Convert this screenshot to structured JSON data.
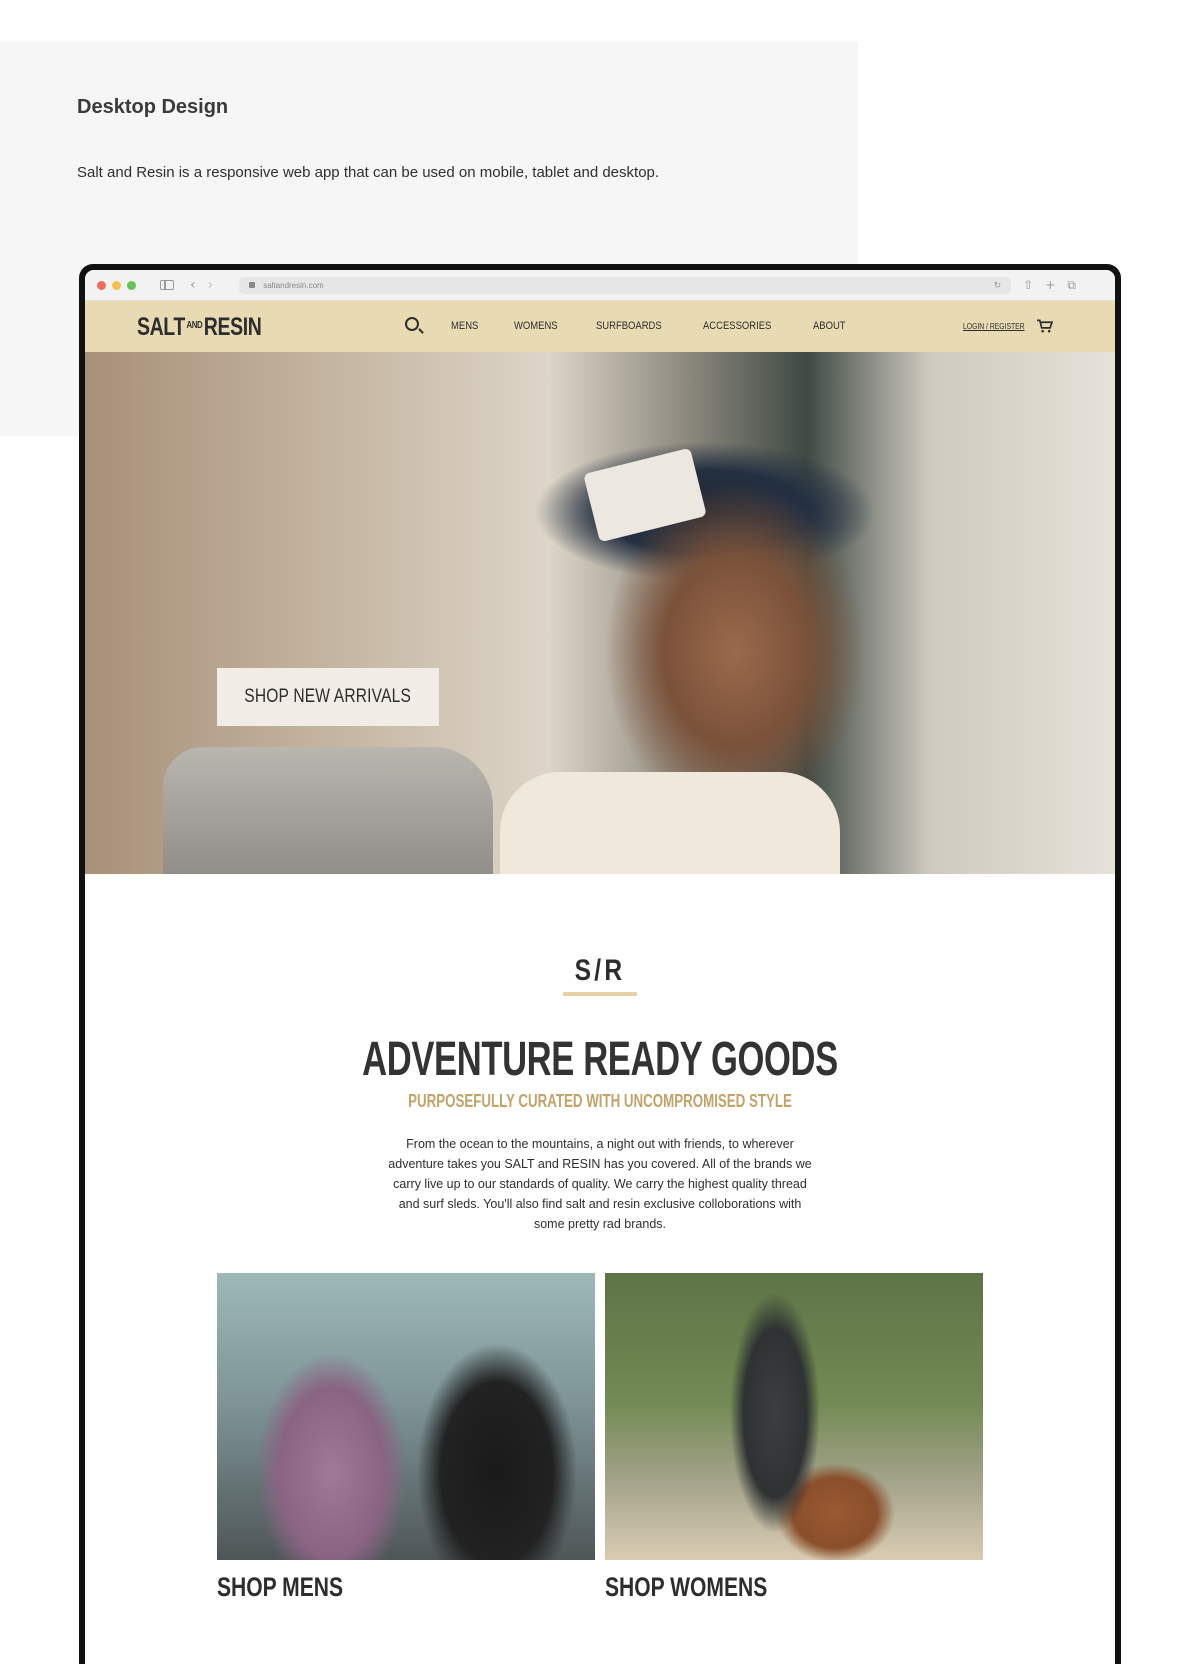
{
  "case_study": {
    "title": "Desktop Design",
    "description": "Salt and Resin is a responsive web app that can be used on mobile, tablet and desktop."
  },
  "browser": {
    "url": "saltandresin.com",
    "traffic_lights": [
      "#ed6b5f",
      "#f5bf4f",
      "#61c554"
    ]
  },
  "site": {
    "logo_left": "SALT",
    "logo_and": "AND",
    "logo_right": "RESIN",
    "nav": [
      "MENS",
      "WOMENS",
      "SURFBOARDS",
      "ACCESSORIES",
      "ABOUT"
    ],
    "login": "LOGIN / REGISTER",
    "colors": {
      "nav_bg": "#e8dbb3",
      "accent": "#c2a36a",
      "rule": "#e6d2a5"
    }
  },
  "hero": {
    "cta_label": "SHOP NEW ARRIVALS"
  },
  "intro": {
    "monogram": "S/R",
    "headline": "ADVENTURE READY GOODS",
    "subhead": "PURPOSEFULLY CURATED WITH UNCOMPROMISED STYLE",
    "body": "From the ocean to the mountains, a night out with friends, to wherever adventure takes you SALT and RESIN has you covered. All of the brands we carry live up to our standards of quality. We carry the highest quality thread and surf sleds. You'll also find salt and resin exclusive colloborations with some pretty rad brands."
  },
  "tiles": [
    {
      "label": "SHOP MENS"
    },
    {
      "label": "SHOP WOMENS"
    }
  ]
}
